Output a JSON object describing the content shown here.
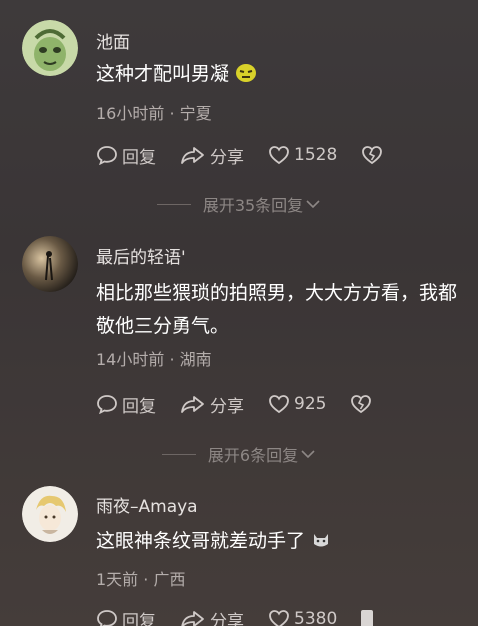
{
  "comments": [
    {
      "name": "池面",
      "text": "这种才配叫男凝",
      "meta": "16小时前 · 宁夏",
      "reply": "回复",
      "share": "分享",
      "likes": "1528",
      "expand": "展开35条回复"
    },
    {
      "name": "最后的轻语'",
      "text_line1": "相比那些猥琐的拍照男，大大方方看，我都",
      "text_line2": "敬他三分勇气。",
      "meta": "14小时前 · 湖南",
      "reply": "回复",
      "share": "分享",
      "likes": "925",
      "expand": "展开6条回复"
    },
    {
      "name": "雨夜–Amaya",
      "text": "这眼神条纹哥就差动手了",
      "meta": "1天前 · 广西",
      "reply": "回复",
      "share": "分享",
      "likes": "5380"
    }
  ],
  "icons": {
    "reply": "reply-bubble-icon",
    "share": "share-arrow-icon",
    "like": "heart-icon",
    "dislike": "broken-heart-icon",
    "expand": "chevron-down-icon"
  },
  "colors": {
    "primary_text": "#ffffff",
    "secondary_text": "#b4adab",
    "muted_text": "#8d8785"
  }
}
